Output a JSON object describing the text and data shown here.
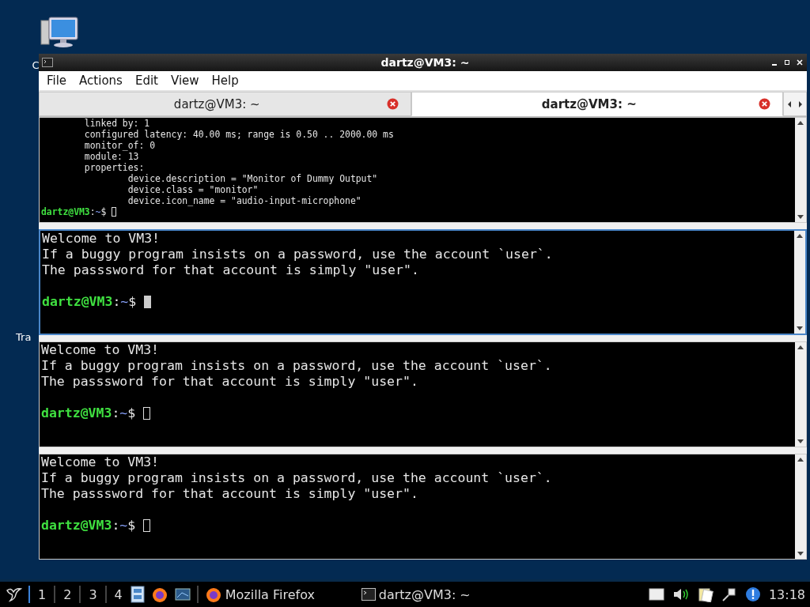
{
  "desktop": {
    "icons": [
      {
        "label": "C",
        "kind": "computer"
      },
      {
        "label": "Tra",
        "kind": "trash"
      }
    ]
  },
  "window": {
    "title": "dartz@VM3: ~"
  },
  "menu": [
    "File",
    "Actions",
    "Edit",
    "View",
    "Help"
  ],
  "tabs": [
    {
      "label": "dartz@VM3: ~",
      "selected": false
    },
    {
      "label": "dartz@VM3: ~",
      "selected": true
    }
  ],
  "panes": [
    {
      "kind": "compact",
      "focused": false,
      "lines": [
        "        linked by: 1",
        "        configured latency: 40.00 ms; range is 0.50 .. 2000.00 ms",
        "        monitor_of: 0",
        "        module: 13",
        "        properties:",
        "                device.description = \"Monitor of Dummy Output\"",
        "                device.class = \"monitor\"",
        "                device.icon_name = \"audio-input-microphone\""
      ],
      "prompt": {
        "user": "dartz@VM3",
        "sep": ":",
        "path": "~",
        "symbol": "$"
      }
    },
    {
      "kind": "normal",
      "focused": true,
      "lines": [
        "Welcome to VM3!",
        "If a buggy program insists on a password, use the account `user`.",
        "The passsword for that account is simply \"user\"."
      ],
      "prompt": {
        "user": "dartz@VM3",
        "sep": ":",
        "path": "~",
        "symbol": "$"
      }
    },
    {
      "kind": "normal",
      "focused": false,
      "lines": [
        "Welcome to VM3!",
        "If a buggy program insists on a password, use the account `user`.",
        "The passsword for that account is simply \"user\"."
      ],
      "prompt": {
        "user": "dartz@VM3",
        "sep": ":",
        "path": "~",
        "symbol": "$"
      }
    },
    {
      "kind": "normal",
      "focused": false,
      "lines": [
        "Welcome to VM3!",
        "If a buggy program insists on a password, use the account `user`.",
        "The passsword for that account is simply \"user\"."
      ],
      "prompt": {
        "user": "dartz@VM3",
        "sep": ":",
        "path": "~",
        "symbol": "$"
      }
    }
  ],
  "taskbar": {
    "workspaces": [
      {
        "label": "1",
        "selected": true
      },
      {
        "label": "2",
        "selected": false
      },
      {
        "label": "3",
        "selected": false
      },
      {
        "label": "4",
        "selected": false
      }
    ],
    "tasks": [
      {
        "label": "Mozilla Firefox",
        "kind": "browser"
      },
      {
        "label": "dartz@VM3: ~",
        "kind": "terminal"
      }
    ],
    "clock": "13:18"
  }
}
